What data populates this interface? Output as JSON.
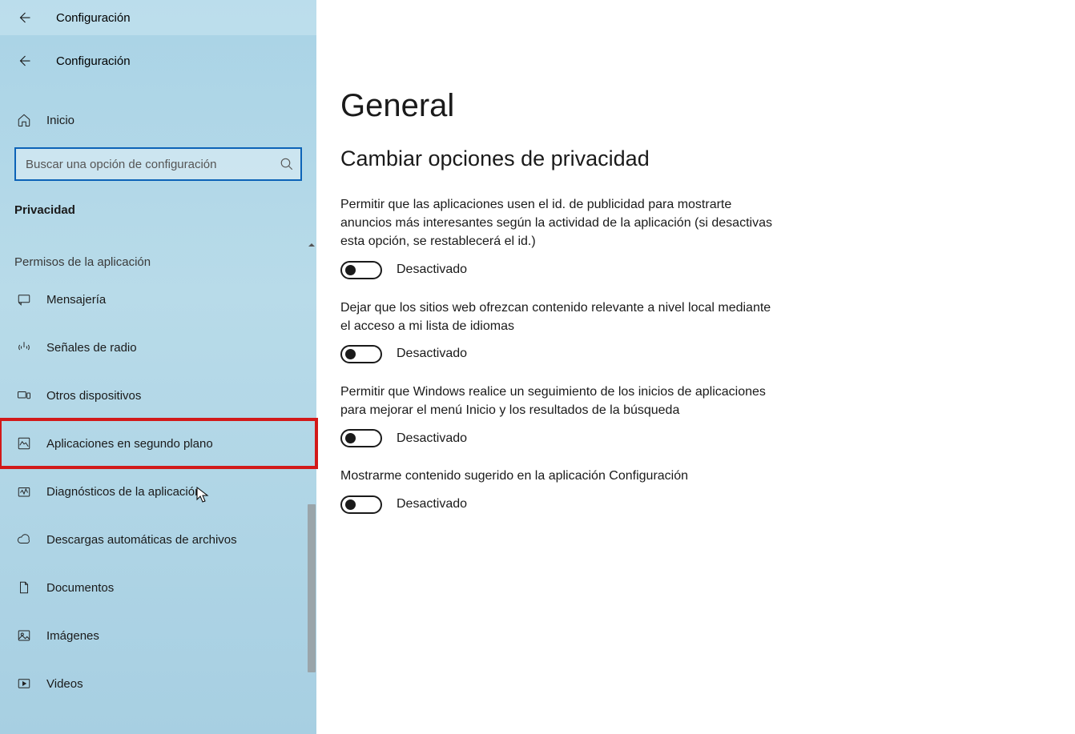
{
  "header": {
    "back_top": "←",
    "title_top": "Configuración",
    "back_second": "←",
    "title_second": "Configuración"
  },
  "sidebar": {
    "home_label": "Inicio",
    "search_placeholder": "Buscar una opción de configuración",
    "section_label": "Privacidad",
    "subsection_label": "Permisos de la aplicación",
    "items": [
      {
        "icon": "messaging",
        "label": "Mensajería"
      },
      {
        "icon": "radio",
        "label": "Señales de radio"
      },
      {
        "icon": "devices",
        "label": "Otros dispositivos"
      },
      {
        "icon": "background",
        "label": "Aplicaciones en segundo plano",
        "highlighted": true
      },
      {
        "icon": "diagnostics",
        "label": "Diagnósticos de la aplicación"
      },
      {
        "icon": "cloud",
        "label": "Descargas automáticas de archivos"
      },
      {
        "icon": "document",
        "label": "Documentos"
      },
      {
        "icon": "image",
        "label": "Imágenes"
      },
      {
        "icon": "video",
        "label": "Videos"
      }
    ]
  },
  "main": {
    "title": "General",
    "subtitle": "Cambiar opciones de privacidad",
    "options": [
      {
        "desc": "Permitir que las aplicaciones usen el id. de publicidad para mostrarte anuncios más interesantes según la actividad de la aplicación (si desactivas esta opción, se restablecerá el id.)",
        "state_label": "Desactivado",
        "on": false
      },
      {
        "desc": "Dejar que los sitios web ofrezcan contenido relevante a nivel local mediante el acceso a mi lista de idiomas",
        "state_label": "Desactivado",
        "on": false
      },
      {
        "desc": "Permitir que Windows realice un seguimiento de los inicios de aplicaciones para mejorar el menú Inicio y los resultados de la búsqueda",
        "state_label": "Desactivado",
        "on": false
      },
      {
        "desc": "Mostrarme contenido sugerido en la aplicación Configuración",
        "state_label": "Desactivado",
        "on": false
      }
    ]
  }
}
